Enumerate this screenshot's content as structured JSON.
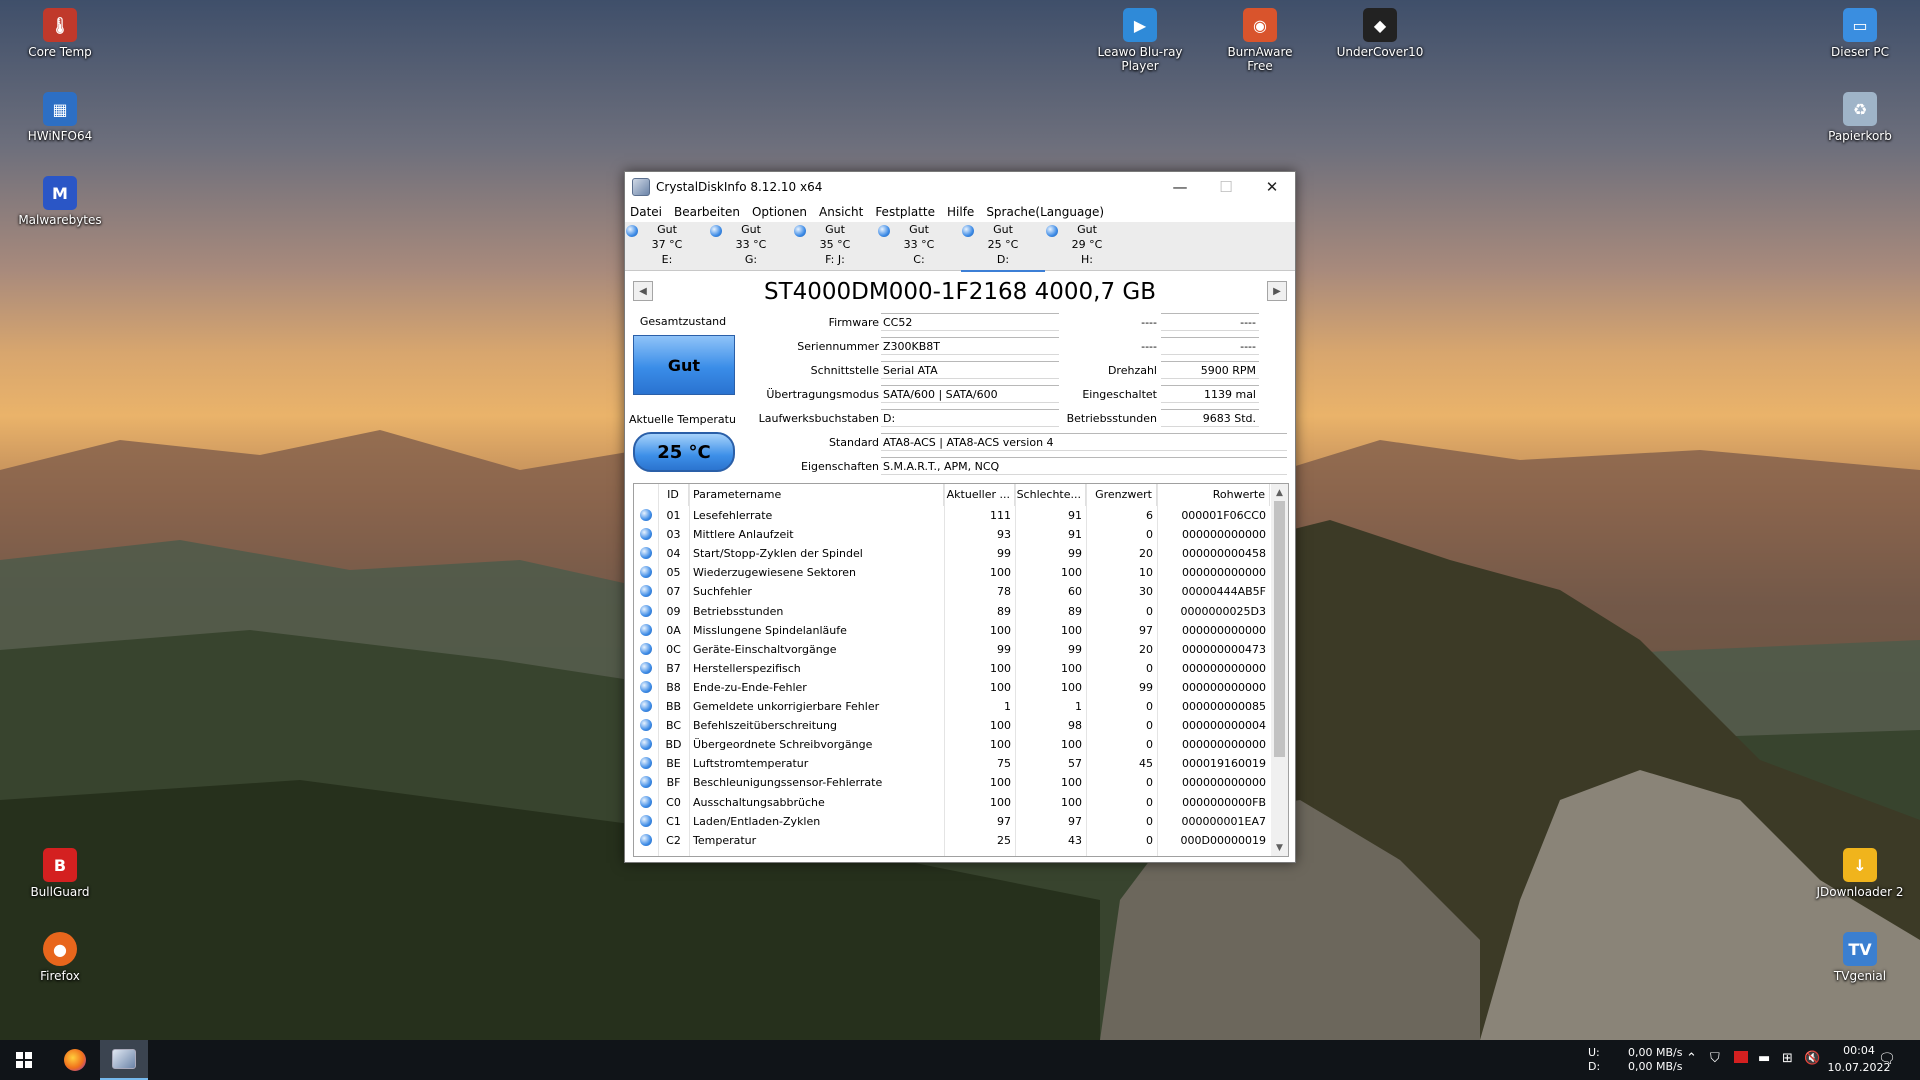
{
  "desktop": {
    "icons": [
      {
        "label": "Core Temp",
        "icon": "core-temp-icon",
        "color": "#c0392b"
      },
      {
        "label": "HWiNFO64",
        "icon": "hwinfo-icon",
        "color": "#2d6fc4"
      },
      {
        "label": "Malwarebytes",
        "icon": "malwarebytes-icon",
        "color": "#2a56c6"
      },
      {
        "label": "Leawo Blu-ray Player",
        "icon": "leawo-icon",
        "color": "#2f8ad8"
      },
      {
        "label": "BurnAware Free",
        "icon": "burnaware-icon",
        "color": "#d9542c"
      },
      {
        "label": "UnderCover10",
        "icon": "undercover-icon",
        "color": "#222222"
      },
      {
        "label": "Dieser PC",
        "icon": "pc-icon",
        "color": "#3a8ee0"
      },
      {
        "label": "Papierkorb",
        "icon": "recycle-bin-icon",
        "color": "#9fb4c8"
      },
      {
        "label": "BullGuard",
        "icon": "bullguard-icon",
        "color": "#d42020"
      },
      {
        "label": "Firefox",
        "icon": "firefox-icon",
        "color": "#e8661c"
      },
      {
        "label": "JDownloader 2",
        "icon": "jdownloader-icon",
        "color": "#f0b41c"
      },
      {
        "label": "TVgenial",
        "icon": "tvgenial-icon",
        "color": "#3b7fd0"
      }
    ]
  },
  "window": {
    "title": "CrystalDiskInfo 8.12.10 x64",
    "menu": [
      "Datei",
      "Bearbeiten",
      "Optionen",
      "Ansicht",
      "Festplatte",
      "Hilfe",
      "Sprache(Language)"
    ],
    "drives": [
      {
        "status": "Gut",
        "temp": "37 °C",
        "letter": "E:"
      },
      {
        "status": "Gut",
        "temp": "33 °C",
        "letter": "G:"
      },
      {
        "status": "Gut",
        "temp": "35 °C",
        "letter": "F: J:"
      },
      {
        "status": "Gut",
        "temp": "33 °C",
        "letter": "C:"
      },
      {
        "status": "Gut",
        "temp": "25 °C",
        "letter": "D:"
      },
      {
        "status": "Gut",
        "temp": "29 °C",
        "letter": "H:"
      }
    ],
    "model": "ST4000DM000-1F2168 4000,7 GB",
    "health_label": "Gesamtzustand",
    "health_value": "Gut",
    "temp_label": "Aktuelle Temperatu",
    "temp_value": "25 °C",
    "info": {
      "firmware_label": "Firmware",
      "firmware": "CC52",
      "serial_label": "Seriennummer",
      "serial": "Z300KB8T",
      "interface_label": "Schnittstelle",
      "interface": "Serial ATA",
      "transfer_label": "Übertragungsmodus",
      "transfer": "SATA/600 | SATA/600",
      "letters_label": "Laufwerksbuchstaben",
      "letters": "D:",
      "standard_label": "Standard",
      "standard": "ATA8-ACS | ATA8-ACS version 4",
      "features_label": "Eigenschaften",
      "features": "S.M.A.R.T., APM, NCQ",
      "blank1_label": "----",
      "blank1": "----",
      "blank2_label": "----",
      "blank2": "----",
      "rpm_label": "Drehzahl",
      "rpm": "5900 RPM",
      "power_count_label": "Eingeschaltet",
      "power_count": "1139 mal",
      "hours_label": "Betriebsstunden",
      "hours": "9683 Std."
    },
    "table": {
      "headers": [
        "ID",
        "Parametername",
        "Aktueller ...",
        "Schlechte...",
        "Grenzwert",
        "Rohwerte"
      ],
      "rows": [
        [
          "01",
          "Lesefehlerrate",
          "111",
          "91",
          "6",
          "000001F06CC0"
        ],
        [
          "03",
          "Mittlere Anlaufzeit",
          "93",
          "91",
          "0",
          "000000000000"
        ],
        [
          "04",
          "Start/Stopp-Zyklen der Spindel",
          "99",
          "99",
          "20",
          "000000000458"
        ],
        [
          "05",
          "Wiederzugewiesene Sektoren",
          "100",
          "100",
          "10",
          "000000000000"
        ],
        [
          "07",
          "Suchfehler",
          "78",
          "60",
          "30",
          "00000444AB5F"
        ],
        [
          "09",
          "Betriebsstunden",
          "89",
          "89",
          "0",
          "0000000025D3"
        ],
        [
          "0A",
          "Misslungene Spindelanläufe",
          "100",
          "100",
          "97",
          "000000000000"
        ],
        [
          "0C",
          "Geräte-Einschaltvorgänge",
          "99",
          "99",
          "20",
          "000000000473"
        ],
        [
          "B7",
          "Herstellerspezifisch",
          "100",
          "100",
          "0",
          "000000000000"
        ],
        [
          "B8",
          "Ende-zu-Ende-Fehler",
          "100",
          "100",
          "99",
          "000000000000"
        ],
        [
          "BB",
          "Gemeldete unkorrigierbare Fehler",
          "1",
          "1",
          "0",
          "000000000085"
        ],
        [
          "BC",
          "Befehlszeitüberschreitung",
          "100",
          "98",
          "0",
          "000000000004"
        ],
        [
          "BD",
          "Übergeordnete Schreibvorgänge",
          "100",
          "100",
          "0",
          "000000000000"
        ],
        [
          "BE",
          "Luftstromtemperatur",
          "75",
          "57",
          "45",
          "000019160019"
        ],
        [
          "BF",
          "Beschleunigungssensor-Fehlerrate",
          "100",
          "100",
          "0",
          "000000000000"
        ],
        [
          "C0",
          "Ausschaltungsabbrüche",
          "100",
          "100",
          "0",
          "0000000000FB"
        ],
        [
          "C1",
          "Laden/Entladen-Zyklen",
          "97",
          "97",
          "0",
          "000000001EA7"
        ],
        [
          "C2",
          "Temperatur",
          "25",
          "43",
          "0",
          "000D00000019"
        ]
      ]
    }
  },
  "taskbar": {
    "net_labels": "U:\nD:",
    "net_up": "0,00 MB/s",
    "net_down": "0,00 MB/s",
    "time": "00:04",
    "date": "10.07.2022"
  }
}
